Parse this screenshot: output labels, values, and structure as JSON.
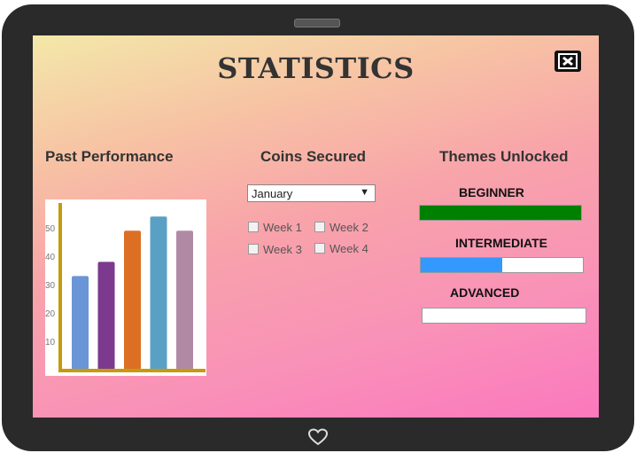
{
  "header": {
    "title": "STATISTICS"
  },
  "icons": {
    "close": "close-x-icon",
    "home": "heart-icon"
  },
  "sections": {
    "past_performance": "Past Performance",
    "coins_secured": "Coins Secured",
    "themes_unlocked": "Themes Unlocked"
  },
  "coins": {
    "month": "January",
    "weeks": [
      "Week 1",
      "Week 2",
      "Week 3",
      "Week 4"
    ]
  },
  "themes": [
    {
      "label": "BEGINNER",
      "progress": 1.0,
      "color": "#008000"
    },
    {
      "label": "INTERMEDIATE",
      "progress": 0.5,
      "color": "#3399ff"
    },
    {
      "label": "ADVANCED",
      "progress": 0.0,
      "color": "#3399ff"
    }
  ],
  "chart_data": {
    "type": "bar",
    "title": "",
    "xlabel": "",
    "ylabel": "",
    "y_ticks": [
      10,
      20,
      30,
      40,
      50
    ],
    "ylim": [
      0,
      60
    ],
    "categories": [
      "",
      "",
      "",
      "",
      ""
    ],
    "values": [
      33,
      38,
      49,
      54,
      49
    ],
    "colors": [
      "#6a95d6",
      "#7b3a8e",
      "#dc6f24",
      "#5aa0c4",
      "#b08aa5"
    ],
    "axis_color": "#c79a0c"
  }
}
